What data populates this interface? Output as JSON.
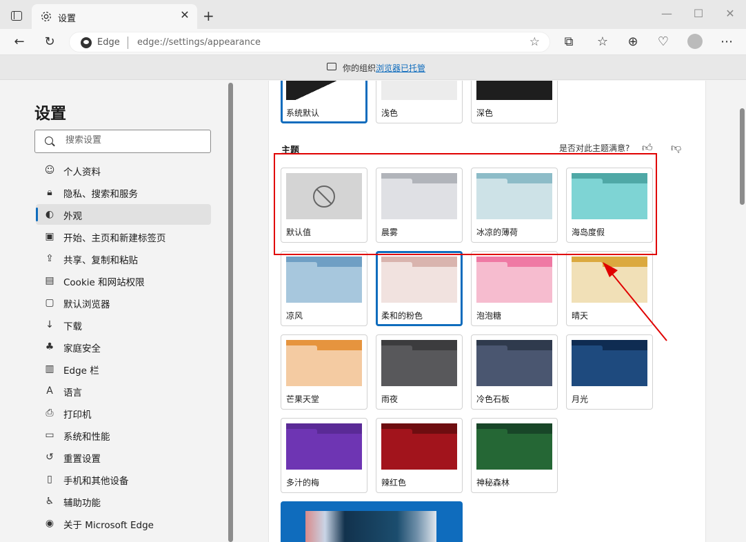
{
  "browser": {
    "tab_title": "设置",
    "address_site": "Edge",
    "address_url": "edge://settings/appearance"
  },
  "managed_bar": {
    "prefix": "你的组织",
    "link": "浏览器已托管"
  },
  "sidebar": {
    "title": "设置",
    "search_placeholder": "搜索设置",
    "items": [
      {
        "label": "个人资料",
        "icon": "profile-icon"
      },
      {
        "label": "隐私、搜索和服务",
        "icon": "lock-icon"
      },
      {
        "label": "外观",
        "icon": "palette-icon",
        "active": true
      },
      {
        "label": "开始、主页和新建标签页",
        "icon": "home-icon"
      },
      {
        "label": "共享、复制和粘贴",
        "icon": "share-icon"
      },
      {
        "label": "Cookie 和网站权限",
        "icon": "cookie-icon"
      },
      {
        "label": "默认浏览器",
        "icon": "browser-icon"
      },
      {
        "label": "下载",
        "icon": "download-icon"
      },
      {
        "label": "家庭安全",
        "icon": "family-icon"
      },
      {
        "label": "Edge 栏",
        "icon": "edge-bar-icon"
      },
      {
        "label": "语言",
        "icon": "language-icon"
      },
      {
        "label": "打印机",
        "icon": "printer-icon"
      },
      {
        "label": "系统和性能",
        "icon": "laptop-icon"
      },
      {
        "label": "重置设置",
        "icon": "reset-icon"
      },
      {
        "label": "手机和其他设备",
        "icon": "phone-icon"
      },
      {
        "label": "辅助功能",
        "icon": "accessibility-icon"
      },
      {
        "label": "关于 Microsoft Edge",
        "icon": "edge-logo-icon"
      }
    ]
  },
  "appearance_modes": [
    {
      "label": "系统默认",
      "selected": true
    },
    {
      "label": "浅色"
    },
    {
      "label": "深色"
    }
  ],
  "themes_section": {
    "title": "主题",
    "feedback_prompt": "是否对此主题满意?"
  },
  "themes": [
    {
      "label": "默认值",
      "band": "#d4d4d4",
      "body": "#d4d4d4",
      "tab": "#d4d4d4",
      "default": true
    },
    {
      "label": "晨雾",
      "band": "#b1b4ba",
      "body": "#dfe0e4",
      "tab": "#dfe0e4"
    },
    {
      "label": "冰凉的薄荷",
      "band": "#8dbcc8",
      "body": "#cde2e7",
      "tab": "#cde2e7"
    },
    {
      "label": "海岛度假",
      "band": "#4fa8a6",
      "body": "#7ed4d4",
      "tab": "#7ed4d4"
    },
    {
      "label": "凉风",
      "band": "#6f9fc4",
      "body": "#a7c7dd",
      "tab": "#a7c7dd"
    },
    {
      "label": "柔和的粉色",
      "band": "#d9b4ae",
      "body": "#f1e2df",
      "tab": "#f1e2df",
      "selected": true
    },
    {
      "label": "泡泡糖",
      "band": "#ef79a4",
      "body": "#f6bccf",
      "tab": "#f6bccf"
    },
    {
      "label": "晴天",
      "band": "#dba93f",
      "body": "#f1e0b7",
      "tab": "#f1e0b7"
    },
    {
      "label": "芒果天堂",
      "band": "#e6943e",
      "body": "#f4cba2",
      "tab": "#f4cba2"
    },
    {
      "label": "雨夜",
      "band": "#3c3c3e",
      "body": "#58585b",
      "tab": "#58585b"
    },
    {
      "label": "冷色石板",
      "band": "#2f3a4d",
      "body": "#4a5670",
      "tab": "#4a5670"
    },
    {
      "label": "月光",
      "band": "#0f2c52",
      "body": "#1e4a7e",
      "tab": "#1e4a7e"
    },
    {
      "label": "多汁的梅",
      "band": "#5a2a96",
      "body": "#6e35b3",
      "tab": "#6e35b3"
    },
    {
      "label": "辣红色",
      "band": "#6e0d10",
      "body": "#a2141c",
      "tab": "#a2141c"
    },
    {
      "label": "神秘森林",
      "band": "#184628",
      "body": "#256735",
      "tab": "#256735"
    }
  ]
}
